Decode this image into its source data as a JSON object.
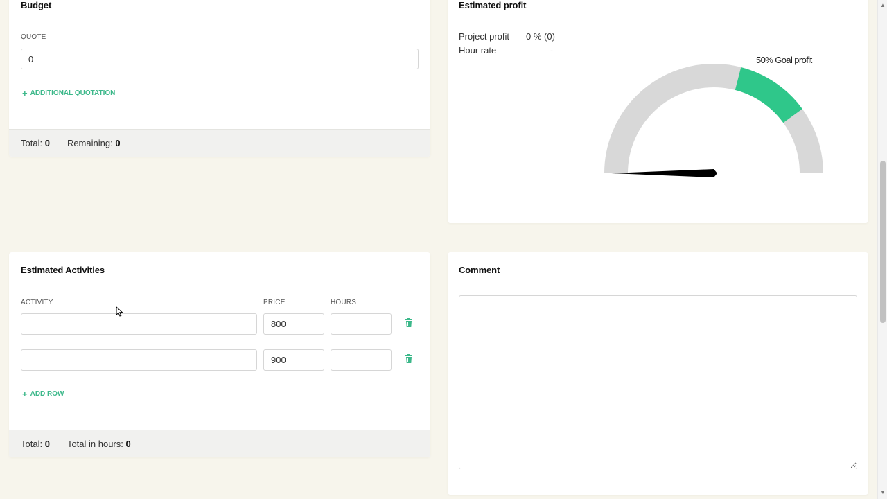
{
  "budget": {
    "title": "Budget",
    "quote_label": "QUOTE",
    "quote_value": "0",
    "add_quotation_label": "ADDITIONAL QUOTATION",
    "footer": {
      "total_label": "Total:",
      "total_value": "0",
      "remaining_label": "Remaining:",
      "remaining_value": "0"
    }
  },
  "profit": {
    "title": "Estimated profit",
    "project_profit_label": "Project profit",
    "project_profit_value": "0 % (0)",
    "hour_rate_label": "Hour rate",
    "hour_rate_value": "-",
    "gauge": {
      "goal_label": "50% Goal profit",
      "goal_fraction": 0.5,
      "goal_band_start": 0.58,
      "goal_band_end": 0.8,
      "needle_fraction": 0.0,
      "track_color": "#d8d8d8",
      "goal_color": "#2fc78a",
      "needle_color": "#000000"
    }
  },
  "activities": {
    "title": "Estimated Activities",
    "columns": [
      "ACTIVITY",
      "PRICE",
      "HOURS"
    ],
    "rows": [
      {
        "activity": "",
        "price": "800",
        "hours": ""
      },
      {
        "activity": "",
        "price": "900",
        "hours": ""
      }
    ],
    "add_row_label": "ADD ROW",
    "footer": {
      "total_label": "Total:",
      "total_value": "0",
      "hours_label": "Total in hours:",
      "hours_value": "0"
    }
  },
  "comment": {
    "title": "Comment",
    "value": ""
  },
  "colors": {
    "accent": "#3cb88a",
    "background": "#f7f5ec"
  }
}
